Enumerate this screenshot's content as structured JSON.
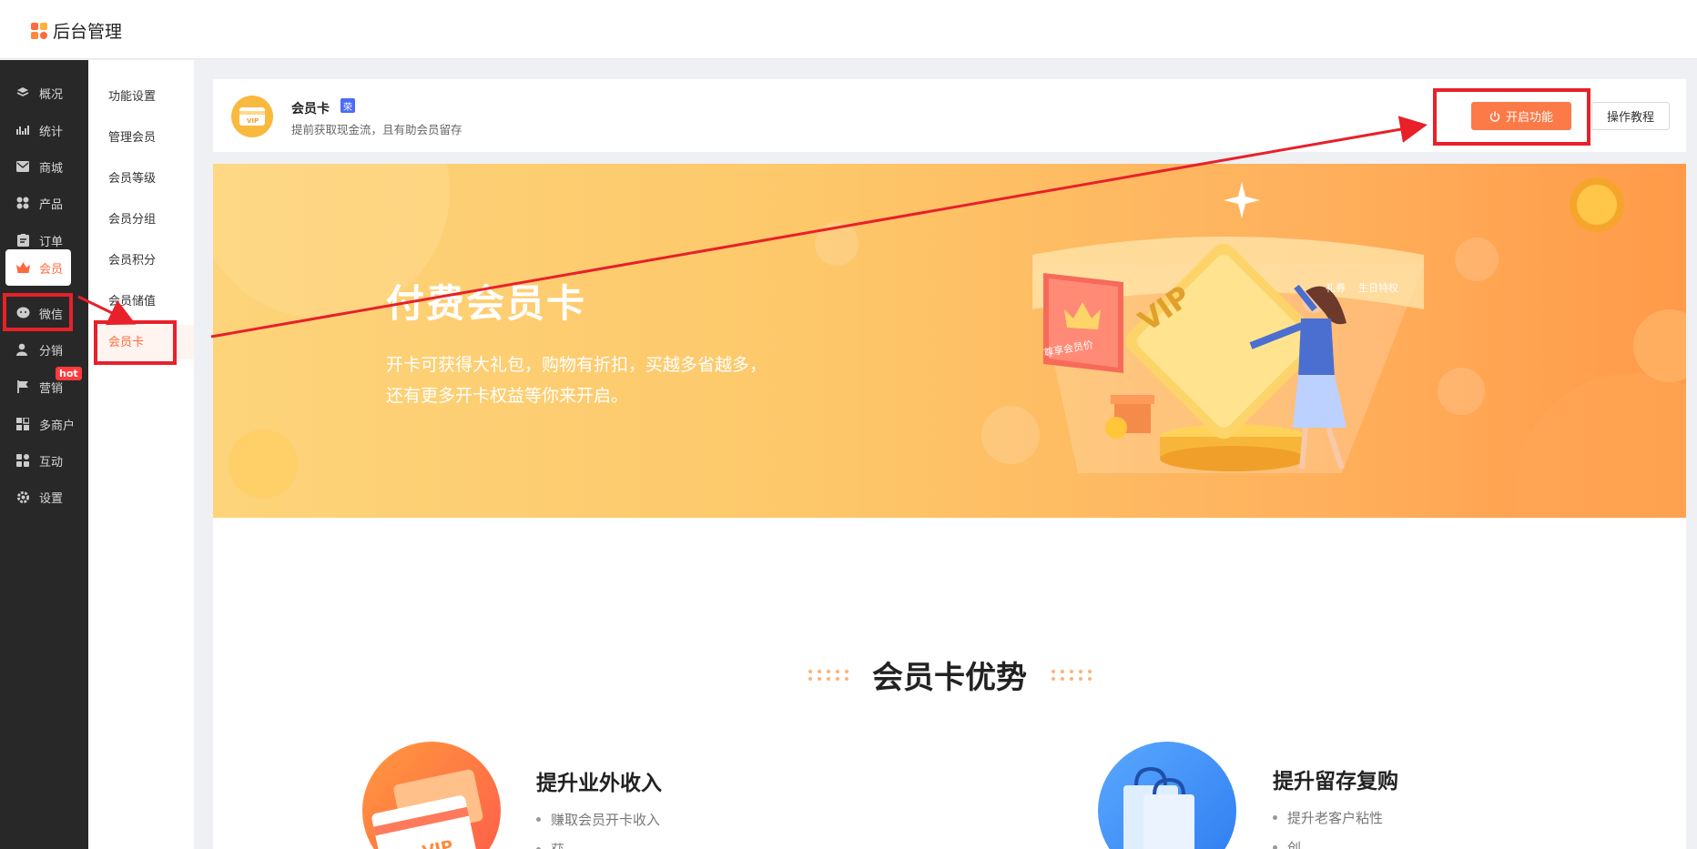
{
  "app": {
    "title": "后台管理"
  },
  "sidebar": {
    "items": [
      {
        "label": "概况",
        "icon": "layers-icon"
      },
      {
        "label": "统计",
        "icon": "chart-icon"
      },
      {
        "label": "商城",
        "icon": "mail-icon"
      },
      {
        "label": "产品",
        "icon": "grid-icon"
      },
      {
        "label": "订单",
        "icon": "clipboard-icon"
      },
      {
        "label": "会员",
        "icon": "crown-icon",
        "active": true
      },
      {
        "label": "微信",
        "icon": "wechat-icon"
      },
      {
        "label": "分销",
        "icon": "user-icon"
      },
      {
        "label": "营销",
        "icon": "flag-icon",
        "badge": "hot"
      },
      {
        "label": "多商户",
        "icon": "store-icon"
      },
      {
        "label": "互动",
        "icon": "interact-icon"
      },
      {
        "label": "设置",
        "icon": "gear-icon"
      }
    ]
  },
  "submenu": {
    "items": [
      {
        "label": "功能设置"
      },
      {
        "label": "管理会员"
      },
      {
        "label": "会员等级"
      },
      {
        "label": "会员分组"
      },
      {
        "label": "会员积分"
      },
      {
        "label": "会员储值"
      },
      {
        "label": "会员卡",
        "active": true
      }
    ]
  },
  "header": {
    "title": "会员卡",
    "tag": "荣",
    "subtitle": "提前获取现金流，且有助会员留存",
    "open_button": "开启功能",
    "tutorial_button": "操作教程"
  },
  "banner": {
    "title": "付费会员卡",
    "desc_line1": "开卡可获得大礼包，购物有折扣，买越多省越多，",
    "desc_line2": "还有更多开卡权益等你来开启。",
    "card_label": "VIP",
    "ribbon_left": "尊享会员价",
    "ribbon_right_1": "礼券",
    "ribbon_right_2": "生日特权"
  },
  "advantages": {
    "title": "会员卡优势",
    "left": {
      "title": "提升业外收入",
      "items": [
        "赚取会员开卡收入",
        "获..."
      ],
      "card_label": "VIP"
    },
    "right": {
      "title": "提升留存复购",
      "items": [
        "提升老客户粘性",
        "创..."
      ]
    }
  },
  "colors": {
    "accent": "#ff6a3d",
    "button": "#fb7a48",
    "annotation": "#e8202a",
    "sidebar_bg": "#282828"
  }
}
